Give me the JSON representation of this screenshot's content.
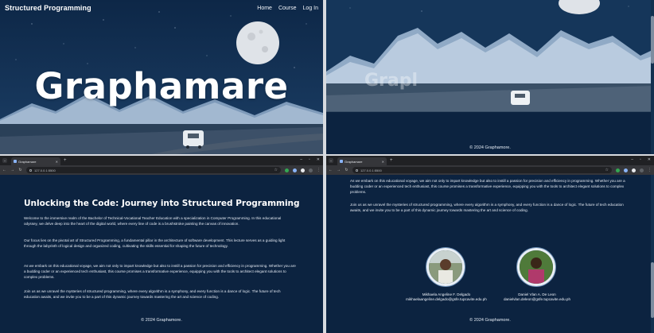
{
  "site": {
    "brand": "Structured Programming",
    "nav": [
      "Home",
      "Course",
      "Log In"
    ],
    "hero_title": "Graphamare",
    "hero_title_partial": "Grapl",
    "footer": "© 2024 Graphamore."
  },
  "browser_left": {
    "tab_title": "Graphamare",
    "url": "127.0.0.1:5500"
  },
  "browser_right": {
    "tab_title": "Graphamare",
    "url": "127.0.0.1:5500"
  },
  "about": {
    "heading": "Unlocking the Code: Journey into Structured Programming",
    "paragraphs": [
      "Welcome to the immersive realm of the Bachelor of Technical-Vocational Teacher Education with a specialization in Computer Programming. In this educational odyssey, we delve deep into the heart of the digital world, where every line of code is a brushstroke painting the canvas of innovation.",
      "Our focus lies on the pivotal art of Structured Programming, a fundamental pillar in the architecture of software development. This lecture serves as a guiding light through the labyrinth of logical design and organized coding, cultivating the skills essential for shaping the future of technology.",
      "As we embark on this educational voyage, we aim not only to impart knowledge but also to instill a passion for precision and efficiency in programming. Whether you are a budding coder or an experienced tech enthusiast, this course promises a transformative experience, equipping you with the tools to architect elegant solutions to complex problems.",
      "Join us as we unravel the mysteries of structured programming, where every algorithm is a symphony, and every function is a dance of logic. The future of tech education awaits, and we invite you to be a part of this dynamic journey towards mastering the art and science of coding."
    ]
  },
  "authors": [
    {
      "name": "Mikhaela Angeline F. Delgado",
      "email": "mikhaelaangeline.delgado@gsfe.tupcavite.edu.ph"
    },
    {
      "name": "Daniel Vlan A. De Leon",
      "email": "danielvlan.deleon@gsfe.tupcavite.edu.ph"
    }
  ],
  "colors": {
    "page_bg": "#0c2340",
    "text": "#e2e8f1",
    "accent_ring": "#e9eff6"
  }
}
